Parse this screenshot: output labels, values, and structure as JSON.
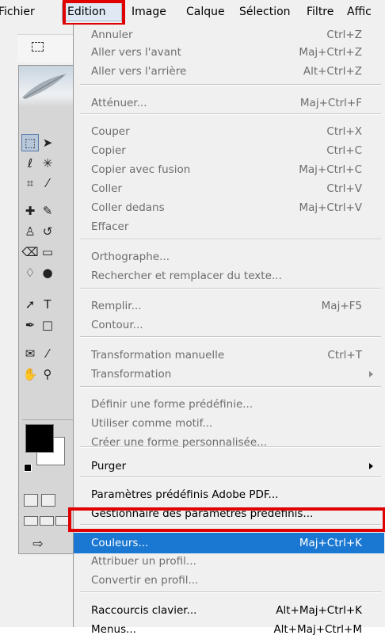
{
  "menubar": {
    "items": [
      "Fichier",
      "Edition",
      "Image",
      "Calque",
      "Sélection",
      "Filtre",
      "Affic"
    ],
    "active": "Edition"
  },
  "menu": {
    "items": [
      {
        "label": "Annuler",
        "shortcut": "Ctrl+Z",
        "enabled": false
      },
      {
        "label": "Aller vers l'avant",
        "shortcut": "Maj+Ctrl+Z",
        "enabled": false
      },
      {
        "label": "Aller vers l'arrière",
        "shortcut": "Alt+Ctrl+Z",
        "enabled": false
      },
      {
        "label": "Atténuer...",
        "shortcut": "Maj+Ctrl+F",
        "enabled": false
      },
      {
        "label": "Couper",
        "shortcut": "Ctrl+X",
        "enabled": false
      },
      {
        "label": "Copier",
        "shortcut": "Ctrl+C",
        "enabled": false
      },
      {
        "label": "Copier avec fusion",
        "shortcut": "Maj+Ctrl+C",
        "enabled": false
      },
      {
        "label": "Coller",
        "shortcut": "Ctrl+V",
        "enabled": false
      },
      {
        "label": "Coller dedans",
        "shortcut": "Maj+Ctrl+V",
        "enabled": false
      },
      {
        "label": "Effacer",
        "shortcut": "",
        "enabled": false
      },
      {
        "label": "Orthographe...",
        "shortcut": "",
        "enabled": false
      },
      {
        "label": "Rechercher et remplacer du texte...",
        "shortcut": "",
        "enabled": false
      },
      {
        "label": "Remplir...",
        "shortcut": "Maj+F5",
        "enabled": false
      },
      {
        "label": "Contour...",
        "shortcut": "",
        "enabled": false
      },
      {
        "label": "Transformation manuelle",
        "shortcut": "Ctrl+T",
        "enabled": false
      },
      {
        "label": "Transformation",
        "shortcut": "",
        "enabled": false,
        "submenu": true
      },
      {
        "label": "Définir une forme prédéfinie...",
        "shortcut": "",
        "enabled": false
      },
      {
        "label": "Utiliser comme motif...",
        "shortcut": "",
        "enabled": false
      },
      {
        "label": "Créer une forme personnalisée...",
        "shortcut": "",
        "enabled": false
      },
      {
        "label": "Purger",
        "shortcut": "",
        "enabled": true,
        "submenu": true
      },
      {
        "label": "Paramètres prédéfinis Adobe PDF...",
        "shortcut": "",
        "enabled": true
      },
      {
        "label": "Gestionnaire des paramètres prédéfinis...",
        "shortcut": "",
        "enabled": true
      },
      {
        "label": "Couleurs...",
        "shortcut": "Maj+Ctrl+K",
        "enabled": true,
        "highlighted": true
      },
      {
        "label": "Attribuer un profil...",
        "shortcut": "",
        "enabled": false
      },
      {
        "label": "Convertir en profil...",
        "shortcut": "",
        "enabled": false
      },
      {
        "label": "Raccourcis clavier...",
        "shortcut": "Alt+Maj+Ctrl+K",
        "enabled": true
      },
      {
        "label": "Menus...",
        "shortcut": "Alt+Maj+Ctrl+M",
        "enabled": true
      }
    ]
  },
  "annotations": {
    "highlight_color": "#e00000",
    "highlighted_menu": "Edition",
    "highlighted_item": "Couleurs..."
  },
  "colors": {
    "menu_bg": "#f0f0f0",
    "selection_blue": "#1b78d2",
    "disabled_text": "#6d6d6d"
  },
  "toolbox": {
    "foreground_color": "#000000",
    "background_color": "#ffffff",
    "icons": [
      "rect-marquee-icon",
      "move-icon",
      "lasso-icon",
      "magic-wand-icon",
      "crop-icon",
      "slice-icon",
      "healing-brush-icon",
      "brush-icon",
      "clone-stamp-icon",
      "history-brush-icon",
      "eraser-icon",
      "gradient-icon",
      "blur-icon",
      "dodge-icon",
      "path-select-icon",
      "type-icon",
      "pen-icon",
      "shape-icon",
      "notes-icon",
      "eyedropper-icon",
      "hand-icon",
      "zoom-icon"
    ]
  }
}
